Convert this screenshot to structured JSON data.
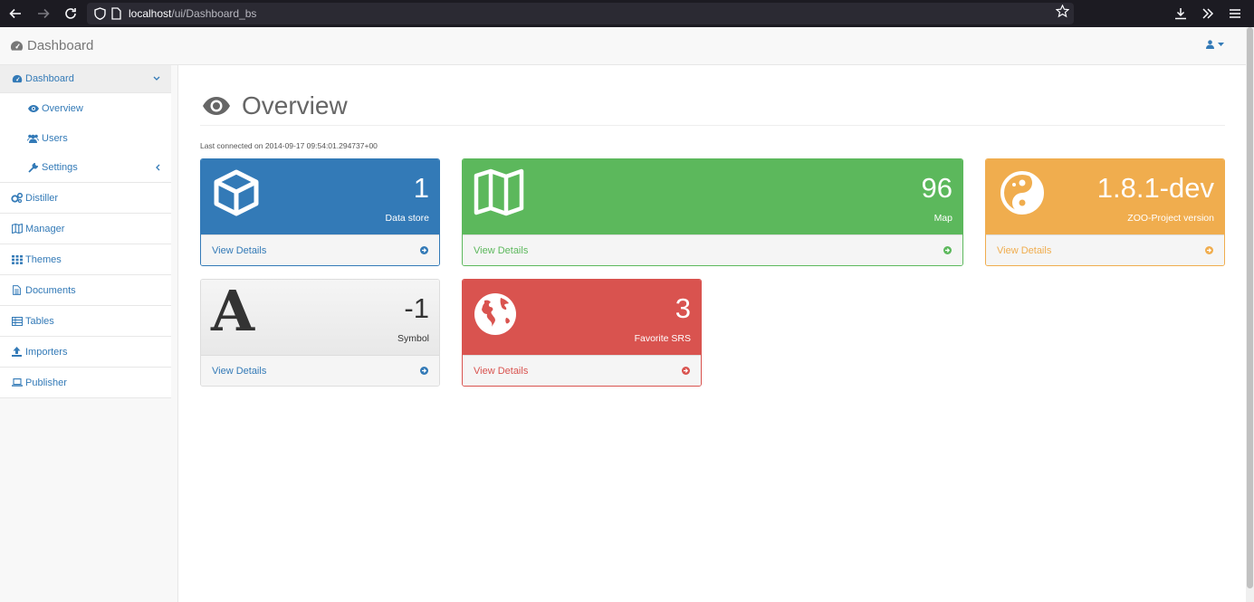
{
  "browser": {
    "url_host": "localhost",
    "url_path": "/ui/Dashboard_bs"
  },
  "navbar": {
    "brand": "Dashboard",
    "brand_icon": "dashboard-icon",
    "user_icon": "user-icon"
  },
  "sidebar": {
    "items": [
      {
        "label": "Dashboard",
        "icon": "dashboard-icon",
        "expanded": true
      },
      {
        "label": "Overview",
        "icon": "eye-icon",
        "sub": true
      },
      {
        "label": "Users",
        "icon": "users-icon",
        "sub": true
      },
      {
        "label": "Settings",
        "icon": "wrench-icon",
        "sub": true
      },
      {
        "label": "Distiller",
        "icon": "cogs-icon"
      },
      {
        "label": "Manager",
        "icon": "map-icon"
      },
      {
        "label": "Themes",
        "icon": "grid-icon"
      },
      {
        "label": "Documents",
        "icon": "file-icon"
      },
      {
        "label": "Tables",
        "icon": "table-icon"
      },
      {
        "label": "Importers",
        "icon": "upload-icon"
      },
      {
        "label": "Publisher",
        "icon": "laptop-icon"
      }
    ]
  },
  "main": {
    "title": "Overview",
    "last_connected": "Last connected on 2014-09-17 09:54:01.294737+00",
    "panels": [
      {
        "value": "1",
        "label": "Data store",
        "link": "View Details",
        "color": "#337ab7",
        "icon": "cube-icon"
      },
      {
        "value": "96",
        "label": "Map",
        "link": "View Details",
        "color": "#5cb85c",
        "icon": "map-icon"
      },
      {
        "value": "1.8.1-dev",
        "label": "ZOO-Project version",
        "link": "View Details",
        "color": "#f0ad4e",
        "icon": "yin-yang-icon"
      },
      {
        "value": "-1",
        "label": "Symbol",
        "link": "View Details",
        "color": "#f5f5f5",
        "icon": "font-icon",
        "icon_text": "A"
      },
      {
        "value": "3",
        "label": "Favorite SRS",
        "link": "View Details",
        "color": "#d9534f",
        "icon": "globe-icon"
      }
    ]
  }
}
